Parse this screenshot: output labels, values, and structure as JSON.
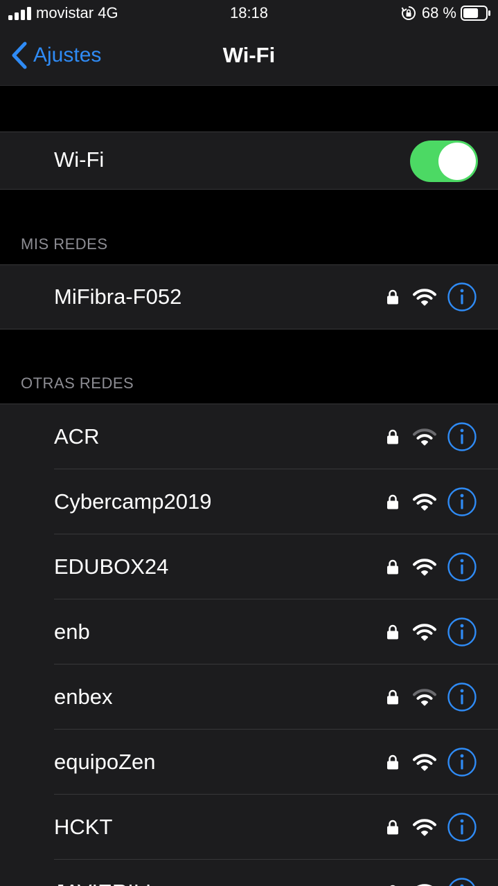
{
  "status_bar": {
    "carrier": "movistar",
    "network_type": "4G",
    "time": "18:18",
    "battery_percent": "68 %",
    "battery_level": 0.68
  },
  "nav": {
    "back_label": "Ajustes",
    "title": "Wi-Fi"
  },
  "wifi_toggle": {
    "label": "Wi-Fi",
    "on": true
  },
  "my_networks": {
    "header": "MIS REDES",
    "items": [
      {
        "name": "MiFibra-F052",
        "secured": true,
        "signal": "full"
      }
    ]
  },
  "other_networks": {
    "header": "OTRAS REDES",
    "items": [
      {
        "name": "ACR",
        "secured": true,
        "signal": "weak"
      },
      {
        "name": "Cybercamp2019",
        "secured": true,
        "signal": "full"
      },
      {
        "name": "EDUBOX24",
        "secured": true,
        "signal": "full"
      },
      {
        "name": "enb",
        "secured": true,
        "signal": "full"
      },
      {
        "name": "enbex",
        "secured": true,
        "signal": "weak"
      },
      {
        "name": "equipoZen",
        "secured": true,
        "signal": "full"
      },
      {
        "name": "HCKT",
        "secured": true,
        "signal": "full"
      },
      {
        "name": "JAVIERILL",
        "secured": true,
        "signal": "full"
      }
    ]
  },
  "colors": {
    "accent": "#2f8bf5",
    "toggle_on": "#4cd964",
    "cell_bg": "#1c1c1e",
    "background": "#000000"
  },
  "icons": {
    "back": "chevron-left-icon",
    "lock": "lock-icon",
    "wifi": "wifi-icon",
    "info": "info-circle-icon"
  }
}
